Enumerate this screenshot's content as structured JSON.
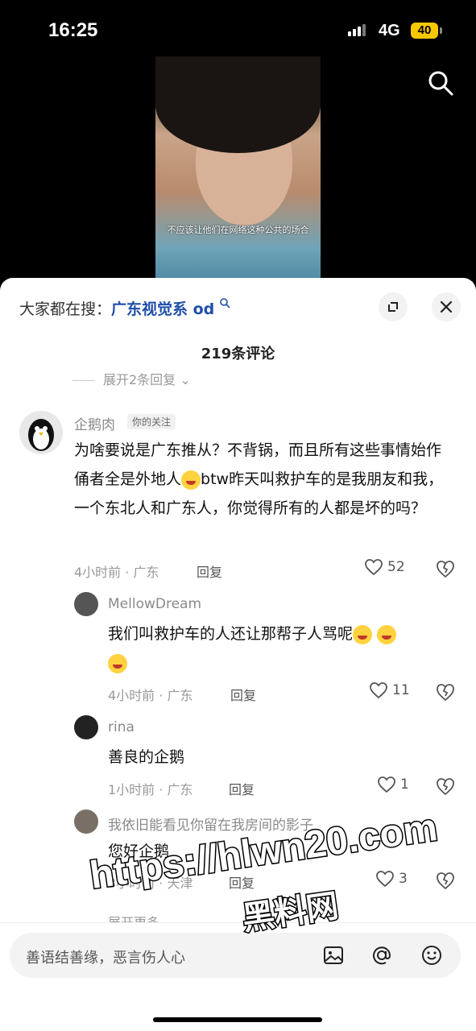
{
  "status_bar": {
    "time": "16:25",
    "network": "4G",
    "battery": "40"
  },
  "video": {
    "caption": "不应该让他们在网络这种公共的场合"
  },
  "sheet": {
    "suggestion_prefix": "大家都在搜：",
    "suggestion_keyword": "广东视觉系 od",
    "comment_count": "219条评论",
    "expand_prev": "展开2条回复"
  },
  "comments": [
    {
      "user": "企鹅肉",
      "tag": "你的关注",
      "text": "为啥要说是广东推从？不背锅，而且所有这些事情始作俑者全是外地人",
      "text_after": "btw昨天叫救护车的是我朋友和我，一个东北人和广东人，你觉得所有的人都是坏的吗？",
      "time": "4小时前 · 广东",
      "reply": "回复",
      "likes": "52"
    },
    {
      "user": "MellowDream",
      "text": "我们叫救护车的人还让那帮子人骂呢",
      "time": "4小时前 · 广东",
      "reply": "回复",
      "likes": "11"
    },
    {
      "user": "rina",
      "text": "善良的企鹅",
      "time": "1小时前 · 广东",
      "reply": "回复",
      "likes": "1"
    },
    {
      "user": "我依旧能看见你留在我房间的影子",
      "text": "您好企鹅",
      "time": "3小时前 · 天津",
      "reply": "回复",
      "likes": "3"
    }
  ],
  "more_replies": "展开更多",
  "input": {
    "placeholder": "善语结善缘，恶言伤人心"
  },
  "watermark": {
    "line1": "https://hlwn20.com",
    "line2": "黑料网"
  }
}
